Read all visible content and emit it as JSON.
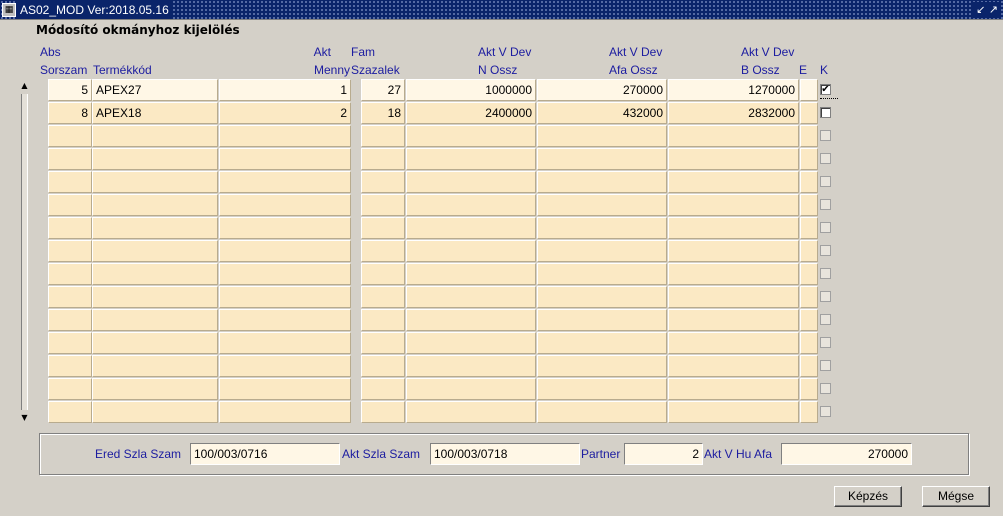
{
  "window": {
    "title": "AS02_MOD Ver:2018.05.16",
    "icon": "oracle-forms-icon",
    "controls": "↙ ↗"
  },
  "section_title": "Módosító okmányhoz kijelölés",
  "columns": {
    "abs_line1": "Abs",
    "abs_line2": "Sorszam",
    "termekkod": "Termékkód",
    "akt_line1": "Akt",
    "akt_line2": "Menny",
    "fam_line1": "Fam",
    "fam_line2": "Szazalek",
    "n_line1": "Akt V Dev",
    "n_line2": "N Ossz",
    "afa_line1": "Akt V Dev",
    "afa_line2": "Afa Ossz",
    "b_line1": "Akt V Dev",
    "b_line2": "B Ossz",
    "e": "E",
    "k": "K"
  },
  "rows": [
    {
      "sorszam": "5",
      "termekkod": "APEX27",
      "menny": "1",
      "szazalek": "27",
      "n_ossz": "1000000",
      "afa_ossz": "270000",
      "b_ossz": "1270000",
      "e": "",
      "k": true
    },
    {
      "sorszam": "8",
      "termekkod": "APEX18",
      "menny": "2",
      "szazalek": "18",
      "n_ossz": "2400000",
      "afa_ossz": "432000",
      "b_ossz": "2832000",
      "e": "",
      "k": false
    },
    {
      "sorszam": "",
      "termekkod": "",
      "menny": "",
      "szazalek": "",
      "n_ossz": "",
      "afa_ossz": "",
      "b_ossz": "",
      "e": "",
      "k": false
    },
    {
      "sorszam": "",
      "termekkod": "",
      "menny": "",
      "szazalek": "",
      "n_ossz": "",
      "afa_ossz": "",
      "b_ossz": "",
      "e": "",
      "k": false
    },
    {
      "sorszam": "",
      "termekkod": "",
      "menny": "",
      "szazalek": "",
      "n_ossz": "",
      "afa_ossz": "",
      "b_ossz": "",
      "e": "",
      "k": false
    },
    {
      "sorszam": "",
      "termekkod": "",
      "menny": "",
      "szazalek": "",
      "n_ossz": "",
      "afa_ossz": "",
      "b_ossz": "",
      "e": "",
      "k": false
    },
    {
      "sorszam": "",
      "termekkod": "",
      "menny": "",
      "szazalek": "",
      "n_ossz": "",
      "afa_ossz": "",
      "b_ossz": "",
      "e": "",
      "k": false
    },
    {
      "sorszam": "",
      "termekkod": "",
      "menny": "",
      "szazalek": "",
      "n_ossz": "",
      "afa_ossz": "",
      "b_ossz": "",
      "e": "",
      "k": false
    },
    {
      "sorszam": "",
      "termekkod": "",
      "menny": "",
      "szazalek": "",
      "n_ossz": "",
      "afa_ossz": "",
      "b_ossz": "",
      "e": "",
      "k": false
    },
    {
      "sorszam": "",
      "termekkod": "",
      "menny": "",
      "szazalek": "",
      "n_ossz": "",
      "afa_ossz": "",
      "b_ossz": "",
      "e": "",
      "k": false
    },
    {
      "sorszam": "",
      "termekkod": "",
      "menny": "",
      "szazalek": "",
      "n_ossz": "",
      "afa_ossz": "",
      "b_ossz": "",
      "e": "",
      "k": false
    },
    {
      "sorszam": "",
      "termekkod": "",
      "menny": "",
      "szazalek": "",
      "n_ossz": "",
      "afa_ossz": "",
      "b_ossz": "",
      "e": "",
      "k": false
    },
    {
      "sorszam": "",
      "termekkod": "",
      "menny": "",
      "szazalek": "",
      "n_ossz": "",
      "afa_ossz": "",
      "b_ossz": "",
      "e": "",
      "k": false
    },
    {
      "sorszam": "",
      "termekkod": "",
      "menny": "",
      "szazalek": "",
      "n_ossz": "",
      "afa_ossz": "",
      "b_ossz": "",
      "e": "",
      "k": false
    },
    {
      "sorszam": "",
      "termekkod": "",
      "menny": "",
      "szazalek": "",
      "n_ossz": "",
      "afa_ossz": "",
      "b_ossz": "",
      "e": "",
      "k": false
    }
  ],
  "footer": {
    "ered_label": "Ered Szla Szam",
    "ered_value": "100/003/0716",
    "akt_label": "Akt Szla Szam",
    "akt_value": "100/003/0718",
    "partner_label": "Partner",
    "partner_value": "2",
    "afa_label": "Akt V Hu Afa",
    "afa_value": "270000"
  },
  "buttons": {
    "kepzes": "Képzés",
    "megse": "Mégse"
  },
  "colors": {
    "titlebar": "#0a246a",
    "field": "#fbe9c4",
    "label": "#1c1ca0",
    "background": "#d4d0c8"
  }
}
